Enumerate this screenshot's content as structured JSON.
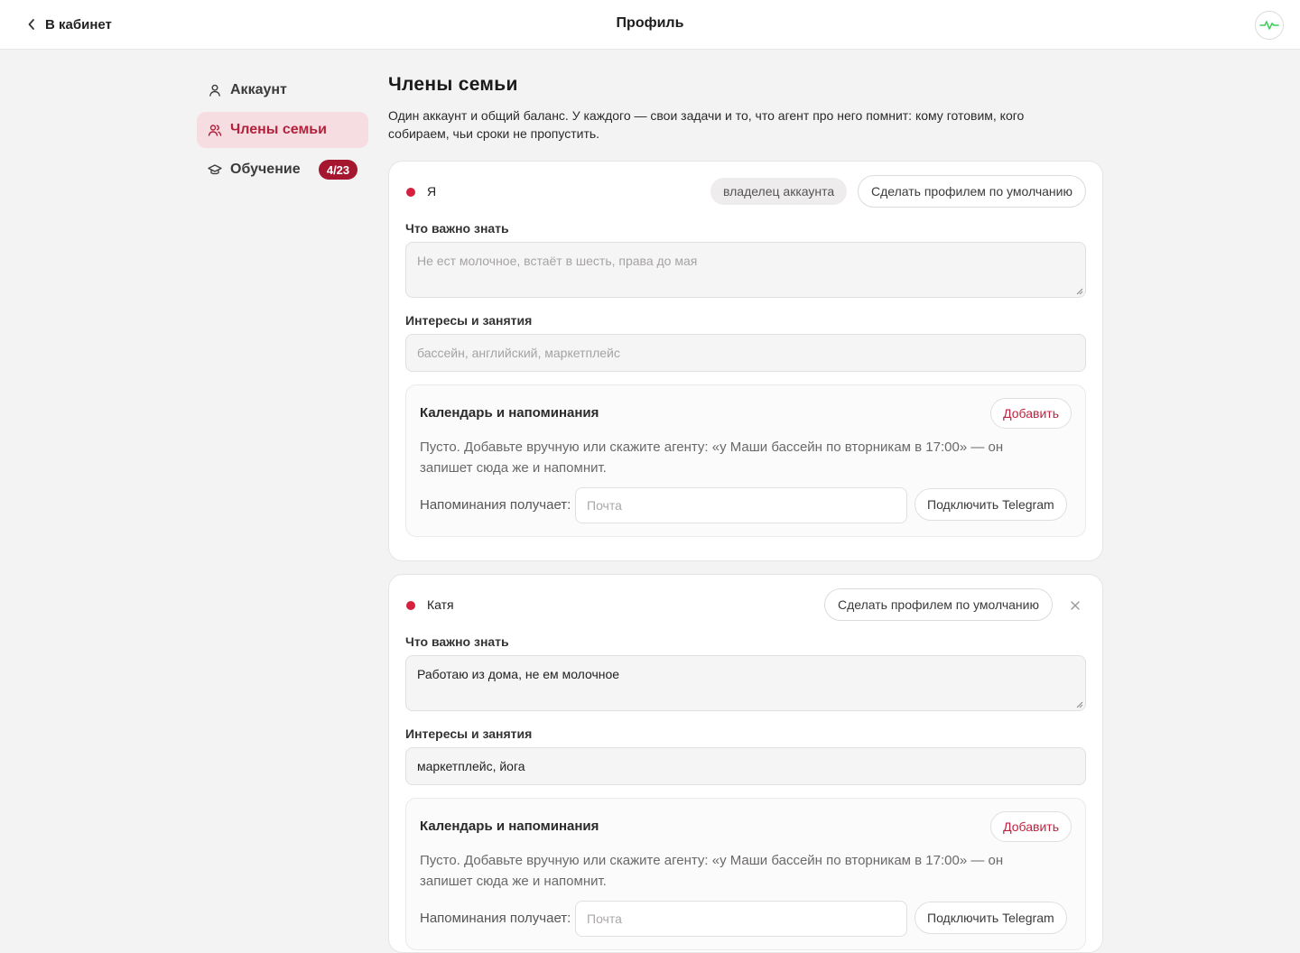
{
  "header": {
    "back_label": "В кабинет",
    "title": "Профиль",
    "back_icon": "chevron-left-icon",
    "status_icon": "pulse-icon",
    "status_color": "#3fcf5a"
  },
  "sidebar": {
    "items": [
      {
        "label": "Аккаунт",
        "icon": "user-icon",
        "active": false
      },
      {
        "label": "Члены семьи",
        "icon": "users-icon",
        "active": true
      },
      {
        "label": "Обучение",
        "icon": "graduation-cap-icon",
        "active": false,
        "badge": "4/23"
      }
    ]
  },
  "main": {
    "title": "Члены семьи",
    "description": "Один аккаунт и общий баланс. У каждого — свои задачи и то, что агент про него помнит: кому готовим, кого собираем, чьи сроки не пропустить."
  },
  "labels": {
    "important": "Что важно знать",
    "interests": "Интересы и занятия",
    "calendar_title": "Календарь и напоминания",
    "add_button": "Добавить",
    "calendar_empty": "Пусто. Добавьте вручную или скажите агенту: «у Маши бассейн по вторникам в 17:00» — он запишет сюда же и напомнит.",
    "reminders_label": "Напоминания получает:",
    "email_placeholder": "Почта",
    "telegram_button": "Подключить Telegram",
    "make_default": "Сделать профилем по умолчанию",
    "owner_badge": "владелец аккаунта"
  },
  "members": [
    {
      "name": "Я",
      "important_value": "",
      "important_placeholder": "Не ест молочное, встаёт в шесть, права до мая",
      "interests_value": "",
      "interests_placeholder": "бассейн, английский, маркетплейс"
    },
    {
      "name": "Катя",
      "important_value": "Работаю из дома, не ем молочное",
      "interests_value": "маркетплейс, йога"
    }
  ],
  "colors": {
    "accent": "#b3213d",
    "dot": "#d5203e",
    "badge": "#a5172e",
    "active_nav_bg": "#f6dde1"
  }
}
